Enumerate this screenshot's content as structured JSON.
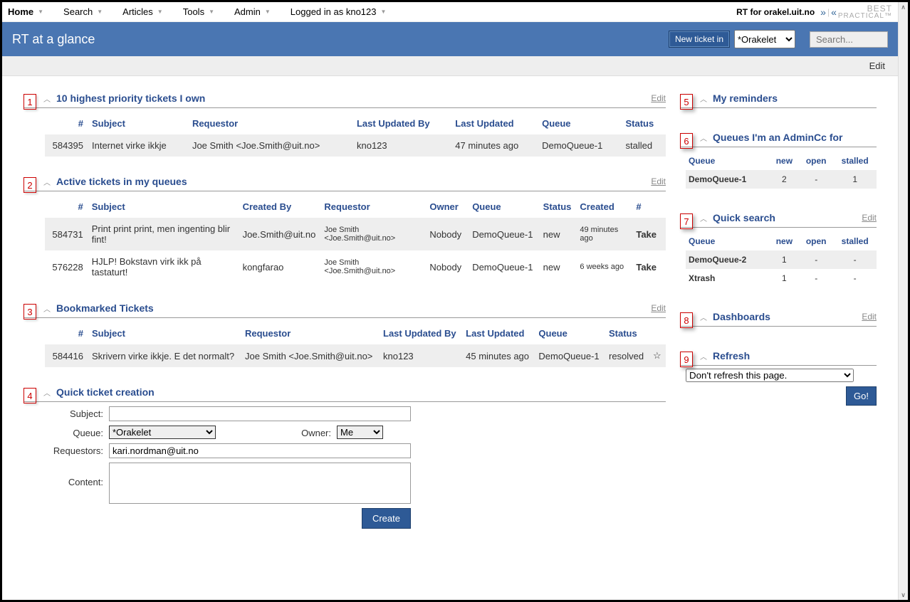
{
  "menu": {
    "items": [
      "Home",
      "Search",
      "Articles",
      "Tools",
      "Admin"
    ],
    "logged_in": "Logged in as kno123",
    "rt_for": "RT for orakel.uit.no",
    "best": "BEST",
    "practical": "PRACTICAL™"
  },
  "banner": {
    "title": "RT at a glance",
    "new_ticket": "New ticket in",
    "queue_selected": "*Orakelet",
    "search_placeholder": "Search..."
  },
  "page_actions": {
    "edit": "Edit"
  },
  "panels": {
    "p1": {
      "num": "1",
      "title": "10 highest priority tickets I own",
      "edit": "Edit"
    },
    "p2": {
      "num": "2",
      "title": "Active tickets in my queues",
      "edit": "Edit"
    },
    "p3": {
      "num": "3",
      "title": "Bookmarked Tickets",
      "edit": "Edit"
    },
    "p4": {
      "num": "4",
      "title": "Quick ticket creation"
    },
    "p5": {
      "num": "5",
      "title": "My reminders"
    },
    "p6": {
      "num": "6",
      "title": "Queues I'm an AdminCc for"
    },
    "p7": {
      "num": "7",
      "title": "Quick search",
      "edit": "Edit"
    },
    "p8": {
      "num": "8",
      "title": "Dashboards",
      "edit": "Edit"
    },
    "p9": {
      "num": "9",
      "title": "Refresh"
    }
  },
  "headers1": {
    "id": "#",
    "subject": "Subject",
    "requestor": "Requestor",
    "last_by": "Last Updated By",
    "last": "Last Updated",
    "queue": "Queue",
    "status": "Status"
  },
  "t1": {
    "r0": {
      "id": "584395",
      "subject": "Internet virke ikkje",
      "requestor": "Joe Smith <Joe.Smith@uit.no>",
      "last_by": "kno123",
      "last": "47 minutes ago",
      "queue": "DemoQueue-1",
      "status": "stalled"
    }
  },
  "headers2": {
    "id": "#",
    "subject": "Subject",
    "created_by": "Created By",
    "requestor": "Requestor",
    "owner": "Owner",
    "queue": "Queue",
    "status": "Status",
    "created": "Created",
    "num": "#"
  },
  "t2": {
    "r0": {
      "id": "584731",
      "subject": "Print print print, men ingenting blir fint!",
      "created_by": "Joe.Smith@uit.no",
      "requestor": "Joe Smith <Joe.Smith@uit.no>",
      "owner": "Nobody",
      "queue": "DemoQueue-1",
      "status": "new",
      "created": "49 minutes ago",
      "action": "Take"
    },
    "r1": {
      "id": "576228",
      "subject": "HJLP! Bokstavn virk ikk på tastaturt!",
      "created_by": "kongfarao",
      "requestor": "Joe Smith <Joe.Smith@uit.no>",
      "owner": "Nobody",
      "queue": "DemoQueue-1",
      "status": "new",
      "created": "6 weeks ago",
      "action": "Take"
    }
  },
  "headers3": {
    "id": "#",
    "subject": "Subject",
    "requestor": "Requestor",
    "last_by": "Last Updated By",
    "last": "Last Updated",
    "queue": "Queue",
    "status": "Status"
  },
  "t3": {
    "r0": {
      "id": "584416",
      "subject": "Skrivern virke ikkje. E det normalt?",
      "requestor": "Joe Smith <Joe.Smith@uit.no>",
      "last_by": "kno123",
      "last": "45 minutes ago",
      "queue": "DemoQueue-1",
      "status": "resolved"
    }
  },
  "quick_create": {
    "subject_label": "Subject:",
    "queue_label": "Queue:",
    "queue_value": "*Orakelet",
    "owner_label": "Owner:",
    "owner_value": "Me",
    "requestors_label": "Requestors:",
    "requestors_value": "kari.nordman@uit.no",
    "content_label": "Content:",
    "create_btn": "Create"
  },
  "queue_headers": {
    "queue": "Queue",
    "new": "new",
    "open": "open",
    "stalled": "stalled"
  },
  "admincc": {
    "r0": {
      "queue": "DemoQueue-1",
      "new": "2",
      "open": "-",
      "stalled": "1"
    }
  },
  "quicksearch": {
    "r0": {
      "queue": "DemoQueue-2",
      "new": "1",
      "open": "-",
      "stalled": "-"
    },
    "r1": {
      "queue": "Xtrash",
      "new": "1",
      "open": "-",
      "stalled": "-"
    }
  },
  "refresh": {
    "selected": "Don't refresh this page.",
    "go": "Go!"
  }
}
